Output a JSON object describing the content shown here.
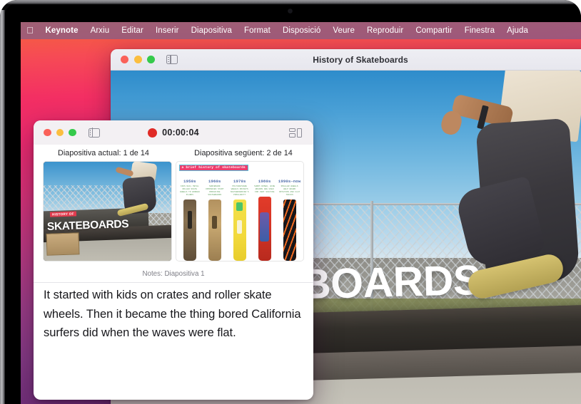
{
  "menubar": {
    "apple_icon": "apple-logo",
    "items": [
      {
        "label": "Keynote",
        "bold": true
      },
      {
        "label": "Arxiu"
      },
      {
        "label": "Editar"
      },
      {
        "label": "Inserir"
      },
      {
        "label": "Diapositiva"
      },
      {
        "label": "Format"
      },
      {
        "label": "Disposició"
      },
      {
        "label": "Veure"
      },
      {
        "label": "Reproduir"
      },
      {
        "label": "Compartir"
      },
      {
        "label": "Finestra"
      },
      {
        "label": "Ajuda"
      }
    ]
  },
  "main_window": {
    "title": "History of Skateboards",
    "traffic_lights": [
      "close",
      "minimize",
      "zoom"
    ],
    "sidebar_icon": "sidebar-toggle-icon",
    "slide_text": "BOARDS"
  },
  "presenter": {
    "traffic_lights": [
      "close",
      "minimize",
      "zoom"
    ],
    "sidebar_icon": "sidebar-toggle-icon",
    "record_icon": "record-dot-icon",
    "timer": "00:00:04",
    "layout_icon": "layout-options-icon",
    "current_label": "Diapositiva actual: 1 de 14",
    "next_label": "Diapositiva següent: 2 de 14",
    "notes_header": "Notes: Diapositiva 1",
    "notes_text": "It started with kids on crates and roller skate wheels. Then it became the thing bored California surfers did when the waves were flat.",
    "current_slide": {
      "banner_small": "HISTORY OF",
      "banner_big": "SKATEBOARDS"
    },
    "next_slide": {
      "title": "a brief history of skateboards",
      "columns": [
        {
          "decade": "1950s",
          "desc": "KIDS NAIL METAL ROLLER SKATE WHEELS TO WOODEN PLANKS"
        },
        {
          "decade": "1960s",
          "desc": "SURFBOARD COMPANIES START PRODUCING SKATEBOARDS"
        },
        {
          "decade": "1970s",
          "desc": "POLYURETHANE WHEELS ROCKETS SKATEBOARDING'S POPULARITY"
        },
        {
          "decade": "1980s",
          "desc": "SHORT-NOSED, WIDE BOARDS ARE USED FOR VERT SKATING"
        },
        {
          "decade": "1990s–now",
          "desc": "SMALLER WHEELS HELP BOARD ROTATION AND FLAT TRICKS"
        }
      ]
    }
  },
  "colors": {
    "accent_record": "#e02b26",
    "traffic_red": "#fa6159",
    "traffic_yellow": "#fbbe3f",
    "traffic_green": "#35ca4b",
    "menubar_tint": "#6c6096",
    "slide_title_pink": "#ee3d6d"
  }
}
